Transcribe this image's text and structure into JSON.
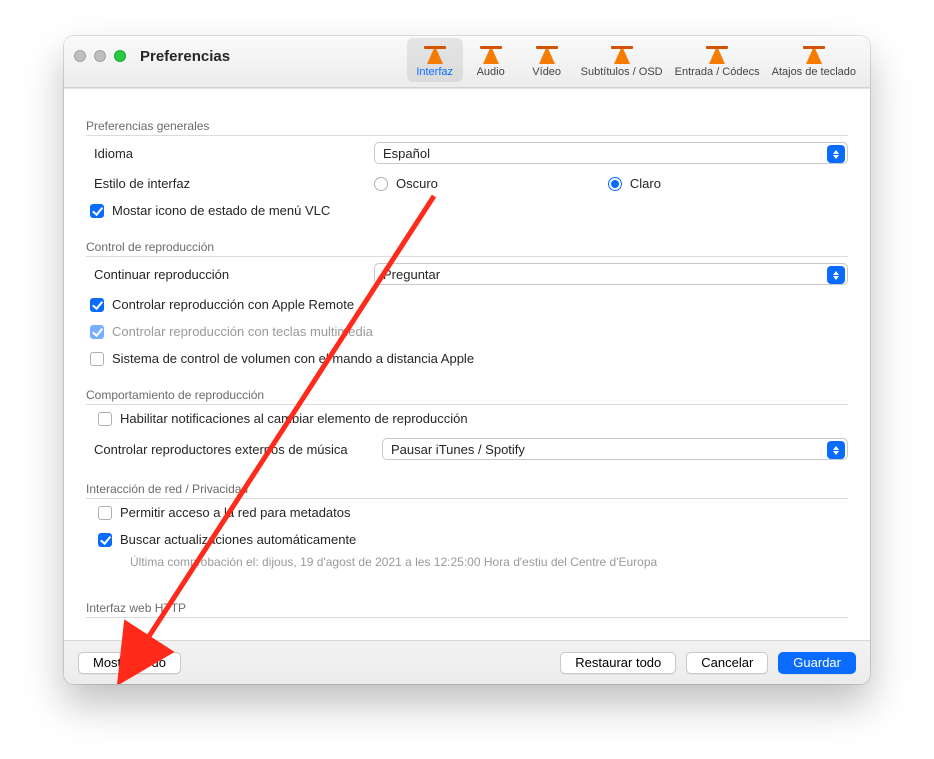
{
  "window": {
    "title": "Preferencias"
  },
  "toolbar": {
    "items": [
      {
        "label": "Interfaz"
      },
      {
        "label": "Audio"
      },
      {
        "label": "Vídeo"
      },
      {
        "label": "Subtítulos / OSD"
      },
      {
        "label": "Entrada / Códecs"
      },
      {
        "label": "Atajos de teclado"
      }
    ]
  },
  "sections": {
    "general": {
      "title": "Preferencias generales",
      "language_label": "Idioma",
      "language_value": "Español",
      "style_label": "Estilo de interfaz",
      "style_dark": "Oscuro",
      "style_light": "Claro",
      "show_menu_icon": "Mostar icono de estado de menú VLC"
    },
    "playback_ctrl": {
      "title": "Control de reproducción",
      "continue_label": "Continuar reproducción",
      "continue_value": "Preguntar",
      "apple_remote": "Controlar reproducción con Apple Remote",
      "media_keys": "Controlar reproducción con teclas multimedia",
      "apple_volume": "Sistema de control de volumen con el mando a distancia Apple"
    },
    "playback_behavior": {
      "title": "Comportamiento de reproducción",
      "notifications": "Habilitar notificaciones al cambiar elemento de reproducción",
      "external_ctrl_label": "Controlar reproductores externos de música",
      "external_ctrl_value": "Pausar iTunes / Spotify"
    },
    "network": {
      "title": "Interacción de red / Privacidad",
      "allow_metadata": "Permitir acceso a la red para metadatos",
      "auto_updates": "Buscar actualizaciones automáticamente",
      "last_check": "Última comprobación el: dijous, 19 d'agost de 2021 a les 12:25:00 Hora d'estiu del Centre d'Europa"
    },
    "http": {
      "title": "Interfaz web HTTP"
    }
  },
  "footer": {
    "show_all": "Mostrar todo",
    "restore": "Restaurar todo",
    "cancel": "Cancelar",
    "save": "Guardar"
  }
}
